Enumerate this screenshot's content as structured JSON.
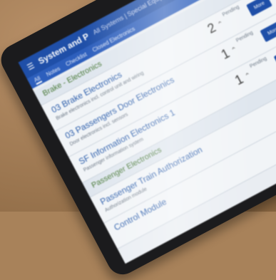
{
  "app": {
    "title": "System and P",
    "breadcrumbs": "All Systems | Special Equipment | Closed Electronics"
  },
  "tabs": [
    "All",
    "Notes",
    "Checklist",
    "Closed Electronics"
  ],
  "rows": [
    {
      "type": "group",
      "name": "Brake - Electronics"
    },
    {
      "type": "item",
      "name": "03 Brake Electronics",
      "sub": "Brake electronics incl. control unit and wiring",
      "qty": "2",
      "status": "Pending",
      "button": "More"
    },
    {
      "type": "item",
      "name": "03 Passengers Door Electronics",
      "sub": "Door electronics incl. sensors",
      "qty": "1",
      "status": "Pending",
      "button": "More"
    },
    {
      "type": "item",
      "name": "SF Information Electronics 1",
      "sub": "Passenger information system",
      "qty": "1",
      "status": "Pending",
      "button": "More"
    },
    {
      "type": "group",
      "name": "Passenger Electronics"
    },
    {
      "type": "item",
      "name": "Passenger Train Authorization",
      "sub": "Authorization module",
      "qty": "",
      "status": "",
      "button": ""
    },
    {
      "type": "item",
      "name": "Control Module",
      "sub": "",
      "qty": "",
      "status": "",
      "button": ""
    }
  ],
  "colors": {
    "desk": "#a8825a",
    "bezel": "#1b1b1d",
    "appbar": "#1f4fa8",
    "link": "#2a5caa",
    "group": "#4a7a3a"
  }
}
